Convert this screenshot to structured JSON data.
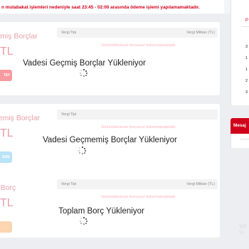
{
  "alert": {
    "text": "n mutabakat işlemleri nedeniyle saat 23:45 - 02:00 arasında ödeme işlemi yapılamamaktadır."
  },
  "cards": [
    {
      "title": "eçmiş Borçlar",
      "amount": "TL",
      "button": "TAY",
      "col_left": "Vergi Tipi",
      "col_right": "Vergi Miktarı (TL)",
      "not_found": "Görüntülenecek borcunuz bulunmamaktadır.",
      "loading": "Vadesi Geçmiş Borçlar Yükleniyor"
    },
    {
      "title": "memiş Borçlar",
      "amount": "TL",
      "button": "EME",
      "col_left": "Vergi Tipi",
      "col_right": "",
      "not_found": "Görüntülenecek borcunuz bulunmamaktadır.",
      "loading": "Vadesi Geçmemiş Borçlar Yükleniyor"
    },
    {
      "title": "m Borç",
      "amount": "TL",
      "button": "",
      "col_left": "Vergi Tipi",
      "col_right": "Vergi Miktarı (TL)",
      "not_found": "Görüntülenecek borcunuz bulunmamaktadır.",
      "loading": "Toplam Borç Yükleniyor"
    }
  ],
  "right_panel": {
    "tab": "P",
    "numbers": [
      "3",
      "1",
      "1",
      "2",
      "3"
    ],
    "message_header": "Mesaj",
    "watermark": "Wi",
    "watermark_sub": "Wi"
  },
  "colors": {
    "alert_red": "#d0021b",
    "title_pink": "#e8a0a8",
    "btn_red": "#f79aa0",
    "btn_blue": "#b9e3f7",
    "btn_orange": "#fbd6b0"
  },
  "icons": {
    "loading": "spinner-icon"
  }
}
